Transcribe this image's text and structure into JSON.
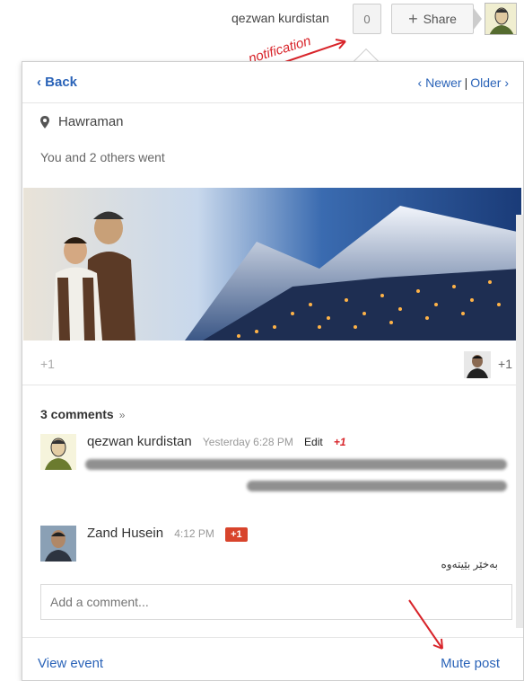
{
  "topbar": {
    "user_name": "qezwan kurdistan",
    "notification_count": "0",
    "share_label": "Share"
  },
  "annotation": {
    "notification_label": "notification"
  },
  "panel": {
    "back_label": "‹ Back",
    "newer_label": "‹ Newer",
    "older_label": "Older ›",
    "pager_separator": "|",
    "location": "Hawraman",
    "attendance": "You and 2 others went",
    "plusone_left": "+1",
    "plusone_right": "+1",
    "comments_header": "3 comments",
    "comments": [
      {
        "author": "qezwan kurdistan",
        "time": "Yesterday 6:28 PM",
        "edit_label": "Edit",
        "plus": "+1"
      },
      {
        "author": "Zand Husein",
        "time": "4:12 PM",
        "plus": "+1",
        "text": "بەخێر بێیتەوە"
      }
    ],
    "add_comment_placeholder": "Add a comment...",
    "view_event_label": "View event",
    "mute_post_label": "Mute post"
  },
  "colors": {
    "link": "#2a63b8",
    "accent_red": "#d8242a",
    "plus_badge": "#d8442c"
  }
}
